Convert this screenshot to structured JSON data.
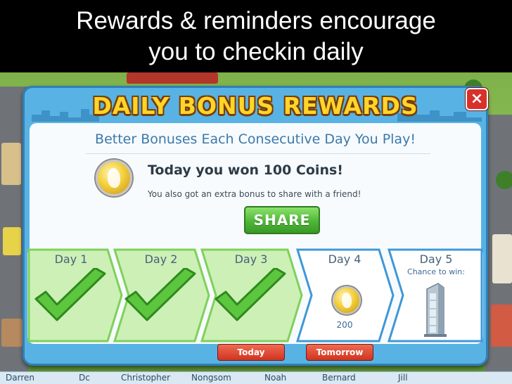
{
  "slide": {
    "line1": "Rewards & reminders encourage",
    "line2": "you to checkin daily"
  },
  "dialog": {
    "title": "DAILY BONUS REWARDS",
    "close_label": "×",
    "subtitle": "Better Bonuses Each Consecutive Day You Play!",
    "won_text": "Today you won 100 Coins!",
    "extra_text": "You also got an extra bonus to share with a friend!",
    "share_label": "SHARE"
  },
  "days": [
    {
      "label": "Day 1",
      "status": "completed"
    },
    {
      "label": "Day 2",
      "status": "completed"
    },
    {
      "label": "Day 3",
      "status": "completed"
    },
    {
      "label": "Day 4",
      "status": "upcoming",
      "reward": "200"
    },
    {
      "label": "Day 5",
      "status": "upcoming",
      "reward_text": "Chance to win:"
    }
  ],
  "markers": {
    "today": "Today",
    "tomorrow": "Tomorrow"
  },
  "friends": [
    "Darren",
    "Dc",
    "Christopher",
    "Nongsom",
    "Noah",
    "Bernard",
    "Jill"
  ],
  "colors": {
    "dialog_border": "#2f7fb7",
    "completed_fill": "#cdf0b7",
    "check_green": "#5cc63f",
    "title_yellow": "#ffd52a",
    "share_green": "#4fb638",
    "marker_red": "#cf3420"
  }
}
